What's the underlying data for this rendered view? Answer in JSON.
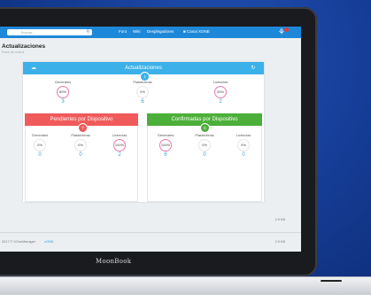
{
  "header": {
    "search_placeholder": "Buscar...",
    "nav": [
      "Foro",
      "Wiki",
      "Desplegadores",
      "Canal XONE"
    ]
  },
  "page": {
    "title": "Actualizaciones",
    "subtitle": "Panel de control"
  },
  "updates_panel": {
    "title": "Actualizaciones",
    "stats": [
      {
        "label": "Generales",
        "percent": "80%",
        "count": "3"
      },
      {
        "label": "Plataformas",
        "percent": "0%",
        "count": "6"
      },
      {
        "label": "Licencias",
        "percent": "40%",
        "count": "2"
      }
    ]
  },
  "pending_panel": {
    "title": "Pendientes por Dispositivo",
    "badge": "7",
    "stats": [
      {
        "label": "Generales",
        "percent": "0%",
        "count": "0"
      },
      {
        "label": "Plataformas",
        "percent": "0%",
        "count": "0"
      },
      {
        "label": "Licencias",
        "percent": "100%",
        "count": "2"
      }
    ]
  },
  "confirmed_panel": {
    "title": "Confirmadas por Dispositivo",
    "badge": "6",
    "stats": [
      {
        "label": "Generales",
        "percent": "100%",
        "count": "6"
      },
      {
        "label": "Plataformas",
        "percent": "0%",
        "count": "0"
      },
      {
        "label": "Licencias",
        "percent": "0%",
        "count": "0"
      }
    ]
  },
  "footer": {
    "left_text": "2017 © XOneManager",
    "logo": "xONE",
    "right_top": "2.9 KB",
    "right_bottom": "2.9 KB"
  },
  "brand": "MoonBook",
  "colors": {
    "topbar": "#1e88d8",
    "updates": "#3cb0e8",
    "pending": "#f05a5a",
    "confirmed": "#4caf3a"
  }
}
